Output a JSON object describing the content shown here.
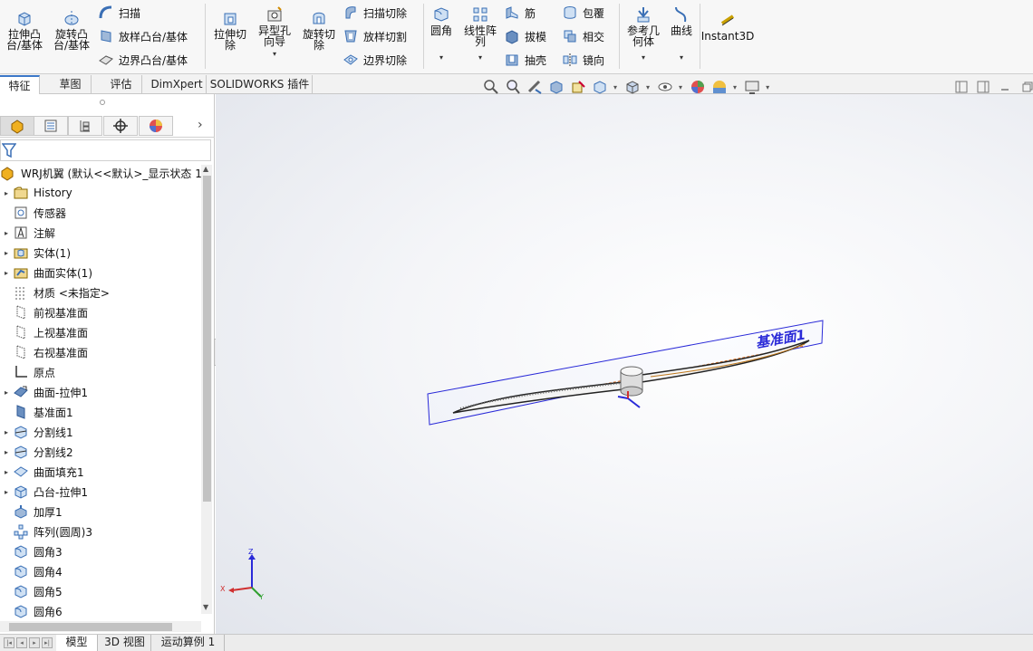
{
  "ribbon": {
    "extrude_boss": "拉伸凸\n台/基体",
    "revolve_boss": "旋转凸\n台/基体",
    "sweep": "扫描",
    "loft_boss": "放样凸台/基体",
    "boundary_boss": "边界凸台/基体",
    "extrude_cut": "拉伸切\n除",
    "hole_wizard": "异型孔\n向导",
    "revolve_cut": "旋转切\n除",
    "swept_cut": "扫描切除",
    "lofted_cut": "放样切割",
    "boundary_cut": "边界切除",
    "fillet": "圆角",
    "linear_pattern": "线性阵\n列",
    "rib": "筋",
    "draft": "拔模",
    "shell": "抽壳",
    "wrap": "包覆",
    "intersect": "相交",
    "mirror": "镜向",
    "ref_geometry": "参考几\n何体",
    "curves": "曲线",
    "instant3d": "Instant3D",
    "dropdown_arrow": "▾"
  },
  "tabs": [
    "特征",
    "草图",
    "评估",
    "DimXpert",
    "SOLIDWORKS 插件"
  ],
  "tree": {
    "root": "WRJ机翼 (默认<<默认>_显示状态 1",
    "items": [
      {
        "label": "History",
        "icon": "history-folder-icon",
        "expand": "▸"
      },
      {
        "label": "传感器",
        "icon": "sensor-icon",
        "expand": ""
      },
      {
        "label": "注解",
        "icon": "annotation-icon",
        "expand": "▸"
      },
      {
        "label": "实体(1)",
        "icon": "solid-bodies-icon",
        "expand": "▸"
      },
      {
        "label": "曲面实体(1)",
        "icon": "surface-bodies-icon",
        "expand": "▸"
      },
      {
        "label": "材质 <未指定>",
        "icon": "material-icon",
        "expand": ""
      },
      {
        "label": "前视基准面",
        "icon": "plane-icon",
        "expand": ""
      },
      {
        "label": "上视基准面",
        "icon": "plane-icon",
        "expand": ""
      },
      {
        "label": "右视基准面",
        "icon": "plane-icon",
        "expand": ""
      },
      {
        "label": "原点",
        "icon": "origin-icon",
        "expand": ""
      },
      {
        "label": "曲面-拉伸1",
        "icon": "surface-extrude-icon",
        "expand": "▸"
      },
      {
        "label": "基准面1",
        "icon": "plane-blue-icon",
        "expand": ""
      },
      {
        "label": "分割线1",
        "icon": "split-line-icon",
        "expand": "▸"
      },
      {
        "label": "分割线2",
        "icon": "split-line-icon",
        "expand": "▸"
      },
      {
        "label": "曲面填充1",
        "icon": "surface-fill-icon",
        "expand": "▸"
      },
      {
        "label": "凸台-拉伸1",
        "icon": "boss-extrude-icon",
        "expand": "▸"
      },
      {
        "label": "加厚1",
        "icon": "thicken-icon",
        "expand": ""
      },
      {
        "label": "阵列(圆周)3",
        "icon": "circular-pattern-icon",
        "expand": ""
      },
      {
        "label": "圆角3",
        "icon": "fillet-icon",
        "expand": ""
      },
      {
        "label": "圆角4",
        "icon": "fillet-icon",
        "expand": ""
      },
      {
        "label": "圆角5",
        "icon": "fillet-icon",
        "expand": ""
      },
      {
        "label": "圆角6",
        "icon": "fillet-icon",
        "expand": ""
      }
    ]
  },
  "viewport": {
    "plane_label": "基准面1",
    "axis_x": "X",
    "axis_y": "Y",
    "axis_z": "Z"
  },
  "bottom_tabs": [
    "模型",
    "3D 视图",
    "运动算例 1"
  ],
  "colors": {
    "plane_blue": "#2a2ad8",
    "accent": "#3c78c8",
    "icon_blue": "#3a6fb5"
  }
}
